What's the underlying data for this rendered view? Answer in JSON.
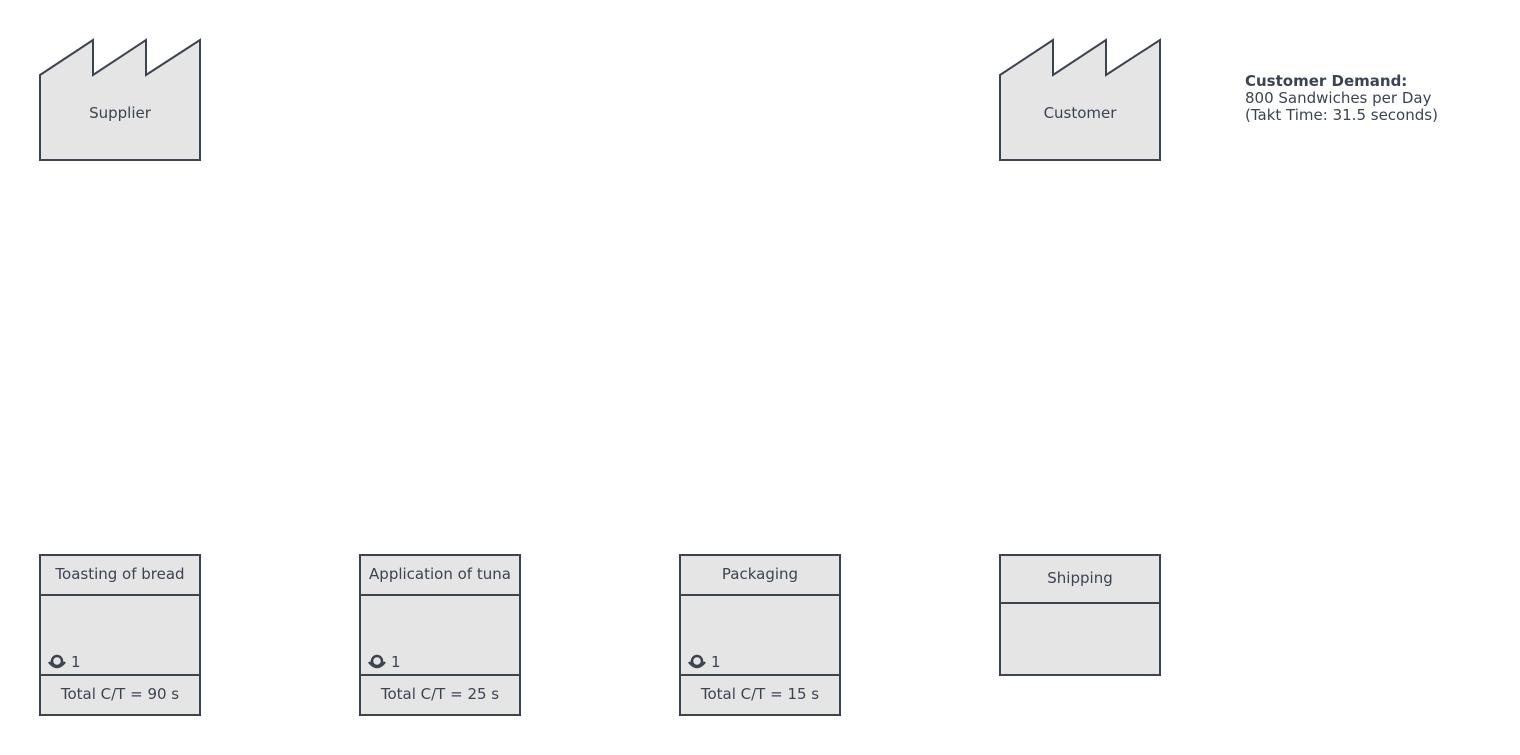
{
  "supplier": {
    "label": "Supplier"
  },
  "customer": {
    "label": "Customer"
  },
  "demand": {
    "title": "Customer Demand:",
    "line1": "800 Sandwiches per Day",
    "line2": "(Takt Time: 31.5 seconds)"
  },
  "processes": [
    {
      "name": "Toasting of bread",
      "operators": "1",
      "cycle_time": "Total C/T = 90 s"
    },
    {
      "name": "Application of tuna",
      "operators": "1",
      "cycle_time": "Total C/T = 25 s"
    },
    {
      "name": "Packaging",
      "operators": "1",
      "cycle_time": "Total C/T = 15 s"
    }
  ],
  "shipping": {
    "label": "Shipping"
  },
  "colors": {
    "fill": "#e5e5e5",
    "stroke": "#3c4450",
    "text": "#3b4452"
  }
}
